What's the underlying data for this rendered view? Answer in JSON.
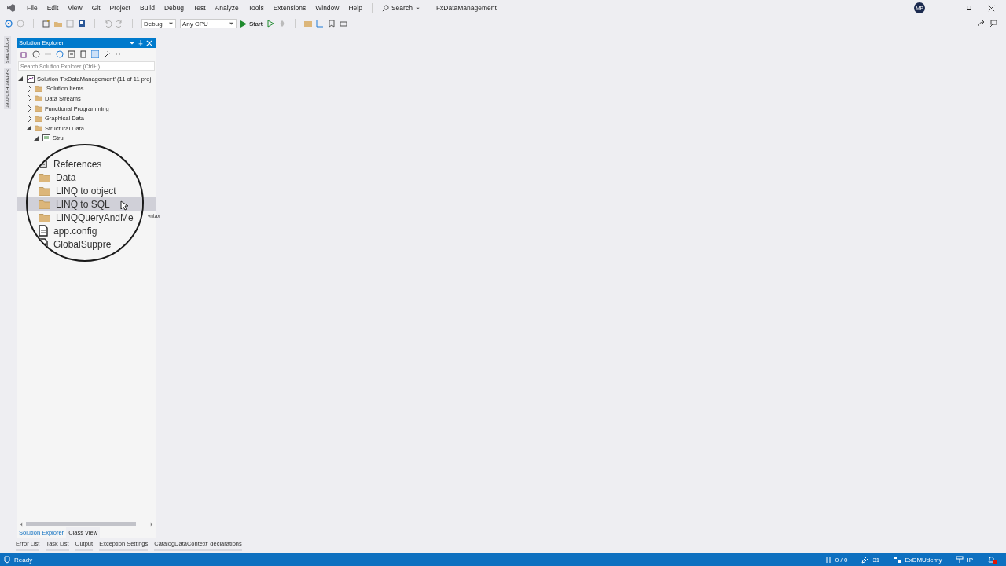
{
  "menu": [
    "File",
    "Edit",
    "View",
    "Git",
    "Project",
    "Build",
    "Debug",
    "Test",
    "Analyze",
    "Tools",
    "Extensions",
    "Window",
    "Help"
  ],
  "search": {
    "label": "Search"
  },
  "solution_name": "FxDataManagement",
  "avatar": "MP",
  "toolbar": {
    "configuration": "Debug",
    "platform": "Any CPU",
    "start": "Start"
  },
  "side_tabs": [
    "Properties",
    "Server Explorer"
  ],
  "solution_explorer": {
    "title": "Solution Explorer",
    "search_placeholder": "Search Solution Explorer (Ctrl+;)",
    "tree": [
      {
        "label": "Solution 'FxDataManagement' (11 of 11 proj",
        "kind": "solution",
        "expanded": true,
        "children": [
          {
            "label": ".Solution Items",
            "kind": "folder",
            "expanded": false
          },
          {
            "label": "Data Streams",
            "kind": "folder",
            "expanded": false
          },
          {
            "label": "Functional Programming",
            "kind": "folder",
            "expanded": false
          },
          {
            "label": "Graphical Data",
            "kind": "folder",
            "expanded": false
          },
          {
            "label": "Structural Data",
            "kind": "folder",
            "expanded": true,
            "children": [
              {
                "label": "Stru",
                "kind": "project",
                "expanded": true
              }
            ]
          }
        ]
      }
    ],
    "magnifier": {
      "items": [
        {
          "label": "References",
          "kind": "references",
          "selected": false
        },
        {
          "label": "Data",
          "kind": "folder",
          "selected": false
        },
        {
          "label": "LINQ to object",
          "kind": "folder",
          "selected": false
        },
        {
          "label": "LINQ to SQL",
          "kind": "folder",
          "selected": true
        },
        {
          "label": "LINQQueryAndMe",
          "kind": "folder",
          "selected": false
        },
        {
          "label": "app.config",
          "kind": "file",
          "selected": false
        },
        {
          "label": "GlobalSuppre",
          "kind": "file",
          "selected": false
        }
      ],
      "peek_text": "yntax"
    },
    "panel_tabs": [
      {
        "label": "Solution Explorer",
        "selected": true
      },
      {
        "label": "Class View",
        "selected": false
      }
    ]
  },
  "tool_tabs": [
    "Error List",
    "Task List",
    "Output",
    "Exception Settings",
    "CatalogDataContext' declarations"
  ],
  "status_bar": {
    "text": "Ready",
    "changes": "0 / 0",
    "edits": "31",
    "repository": "ExDMUdemy",
    "branch": "IP"
  }
}
